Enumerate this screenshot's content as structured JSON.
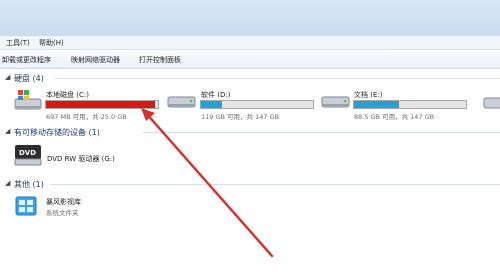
{
  "menu": {
    "tools": "工具(T)",
    "help": "帮助(H)"
  },
  "toolbar": {
    "uninstall": "卸载或更改程序",
    "map_drive": "映射网络驱动器",
    "control_panel": "打开控制面板"
  },
  "sections": {
    "hard_disks": "硬盘 (4)",
    "removable": "有可移动存储的设备 (1)",
    "other": "其他 (1)"
  },
  "drives": [
    {
      "name": "本地磁盘 (C:)",
      "info": "697 MB 可用，共 25.0 GB",
      "used_fraction": 0.97,
      "color": "#d21a1a"
    },
    {
      "name": "软件 (D:)",
      "info": "119 GB 可用，共 147 GB",
      "used_fraction": 0.19,
      "color": "#26a0da"
    },
    {
      "name": "文档 (E:)",
      "info": "88.5 GB 可用，共 147 GB",
      "used_fraction": 0.4,
      "color": "#26a0da"
    }
  ],
  "dvd": {
    "name": "DVD RW 驱动器 (G:)",
    "badge": "DVD"
  },
  "other_item": {
    "name": "暴风影视库",
    "type": "系统文件夹"
  },
  "colors": {
    "arrow": "#d6302b",
    "section_title": "#1e3d6b",
    "bar_empty": "#e6e6e6"
  }
}
